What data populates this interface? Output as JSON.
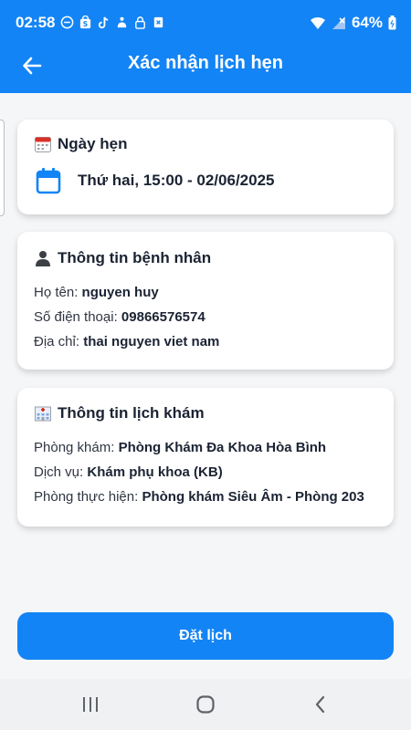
{
  "status": {
    "time": "02:58",
    "battery": "64%",
    "left_icons": [
      "minus-circle-icon",
      "shopee-icon",
      "tiktok-icon",
      "guide-icon",
      "lock-icon",
      "file-icon"
    ],
    "right_icons": [
      "wifi-icon",
      "no-signal-icon",
      "battery-icon"
    ]
  },
  "appbar": {
    "title": "Xác nhận lịch hẹn",
    "back_icon": "arrow-left-icon"
  },
  "appointment_card": {
    "icon": "calendar-emoji-icon",
    "title": "Ngày hẹn",
    "date_icon": "calendar-icon",
    "date_text": "Thứ hai, 15:00 - 02/06/2025"
  },
  "patient_card": {
    "icon": "person-emoji-icon",
    "title": "Thông tin bệnh nhân",
    "rows": [
      {
        "label": "Họ tên:",
        "value": "nguyen huy"
      },
      {
        "label": "Số điện thoại:",
        "value": "09866576574"
      },
      {
        "label": "Địa chỉ:",
        "value": "thai nguyen viet nam"
      }
    ]
  },
  "exam_card": {
    "icon": "hospital-emoji-icon",
    "title": "Thông tin lịch khám",
    "rows": [
      {
        "label": "Phòng khám:",
        "value": "Phòng Khám Đa Khoa Hòa Bình"
      },
      {
        "label": "Dịch vụ:",
        "value": "Khám phụ khoa (KB)"
      },
      {
        "label": "Phòng thực hiện:",
        "value": "Phòng khám Siêu Âm - Phòng 203"
      }
    ]
  },
  "book_button": {
    "label": "Đặt lịch"
  },
  "colors": {
    "primary": "#1384f5",
    "background": "#f5f6f8",
    "card": "#ffffff"
  },
  "navbar": {
    "icons": [
      "recent-apps-icon",
      "home-icon",
      "back-icon"
    ]
  }
}
